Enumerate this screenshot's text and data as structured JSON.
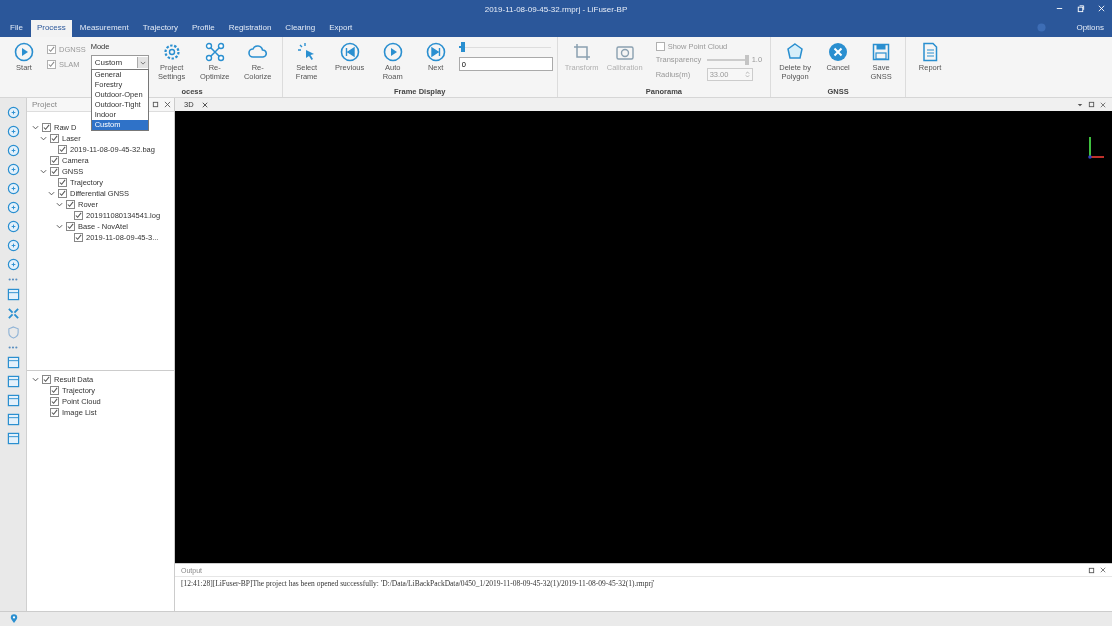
{
  "window": {
    "title": "2019-11-08-09-45-32.rmprj - LiFuser-BP",
    "options": "Options"
  },
  "menu_tabs": [
    {
      "label": "File",
      "selected": false
    },
    {
      "label": "Process",
      "selected": true
    },
    {
      "label": "Measurement",
      "selected": false
    },
    {
      "label": "Trajectory",
      "selected": false
    },
    {
      "label": "Profile",
      "selected": false
    },
    {
      "label": "Registration",
      "selected": false
    },
    {
      "label": "Clearing",
      "selected": false
    },
    {
      "label": "Export",
      "selected": false
    }
  ],
  "ribbon": {
    "process": {
      "start": "Start",
      "checks": [
        {
          "label": "DGNSS",
          "checked": true
        },
        {
          "label": "SLAM",
          "checked": true
        }
      ],
      "mode_label": "Mode",
      "mode_value": "Custom",
      "mode_options": [
        {
          "label": "General",
          "selected": false
        },
        {
          "label": "Forestry",
          "selected": false
        },
        {
          "label": "Outdoor-Open",
          "selected": false
        },
        {
          "label": "Outdoor-Tight",
          "selected": false
        },
        {
          "label": "Indoor",
          "selected": false
        },
        {
          "label": "Custom",
          "selected": true
        }
      ],
      "buttons": [
        "Project Settings",
        "Re-Optimize",
        "Re-Colorize"
      ],
      "group_label": "ocess"
    },
    "frame_display": {
      "buttons": [
        "Select Frame",
        "Previous",
        "Auto Roam",
        "Next"
      ],
      "frame_slider": {
        "level": 0.02
      },
      "frame_value": "0",
      "group_label": "Frame Display"
    },
    "panorama": {
      "buttons": [
        "Transform",
        "Calibration"
      ],
      "show_point_cloud": {
        "label": "Show Point Cloud",
        "checked": false
      },
      "transparency": {
        "label": "Transparency",
        "level": 1.0,
        "reading": "1.0"
      },
      "radius_label": "Radius(m)",
      "radius_value": "33.00",
      "group_label": "Panorama"
    },
    "gnss": {
      "buttons": [
        "Delete by Polygon",
        "Cancel",
        "Save GNSS"
      ],
      "group_label": "GNSS"
    },
    "report": "Report"
  },
  "project_panel": {
    "title": "Project",
    "tree": [
      {
        "label": "Raw D",
        "checked": true,
        "expanded": true,
        "children": [
          {
            "label": "Laser",
            "checked": true,
            "expanded": true,
            "children": [
              {
                "label": "2019-11-08-09-45-32.bag",
                "checked": true
              }
            ]
          },
          {
            "label": "Camera",
            "checked": true
          },
          {
            "label": "GNSS",
            "checked": true,
            "expanded": true,
            "children": [
              {
                "label": "Trajectory",
                "checked": true
              },
              {
                "label": "Differential GNSS",
                "checked": true,
                "expanded": true,
                "children": [
                  {
                    "label": "Rover",
                    "checked": true,
                    "expanded": true,
                    "children": [
                      {
                        "label": "201911080134541.log",
                        "checked": true
                      }
                    ]
                  },
                  {
                    "label": "Base - NovAtel",
                    "checked": true,
                    "expanded": true,
                    "children": [
                      {
                        "label": "2019-11-08-09-45-3...",
                        "checked": true
                      }
                    ]
                  }
                ]
              }
            ]
          }
        ]
      }
    ],
    "result_tree": [
      {
        "label": "Result Data",
        "checked": true,
        "expanded": true,
        "children": [
          {
            "label": "Trajectory",
            "checked": true
          },
          {
            "label": "Point Cloud",
            "checked": true
          },
          {
            "label": "Image List",
            "checked": true
          }
        ]
      }
    ]
  },
  "view_tabs": [
    {
      "label": "3D",
      "selected": true
    }
  ],
  "output": {
    "title": "Output",
    "lines": [
      "[12:41:28][LiFuser-BP]The project has been opened successfully: 'D:/Data/LiBackPackData/0450_1/2019-11-08-09-45-32(1)/2019-11-08-09-45-32(1).rmprj'"
    ]
  }
}
